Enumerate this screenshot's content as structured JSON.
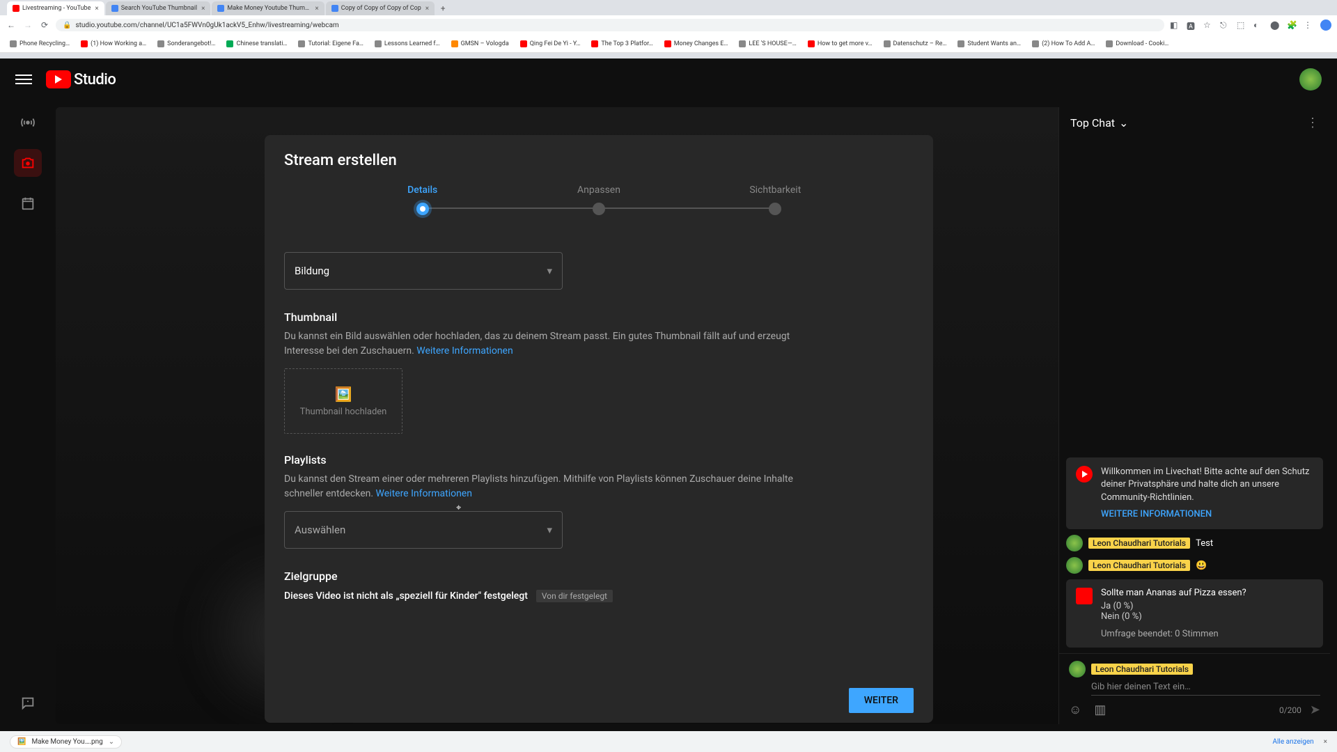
{
  "browser": {
    "tabs": [
      {
        "title": "Livestreaming - YouTube",
        "active": true
      },
      {
        "title": "Search YouTube Thumbnail",
        "active": false
      },
      {
        "title": "Make Money Youtube Thumbn",
        "active": false
      },
      {
        "title": "Copy of Copy of Copy of Cop",
        "active": false
      }
    ],
    "url": "studio.youtube.com/channel/UC1a5FWVn0gUk1ackV5_Enhw/livestreaming/webcam",
    "bookmarks": [
      "Phone Recycling…",
      "(1) How Working a…",
      "Sonderangebot!…",
      "Chinese translati…",
      "Tutorial: Eigene Fa…",
      "Lessons Learned f…",
      "GMSN – Vologda",
      "Qing Fei De Yi - Y…",
      "The Top 3 Platfor…",
      "Money Changes E…",
      "LEE 'S HOUSE—…",
      "How to get more v…",
      "Datenschutz – Re…",
      "Student Wants an…",
      "(2) How To Add A…",
      "Download - Cooki…"
    ]
  },
  "header": {
    "logo_text": "Studio"
  },
  "dialog": {
    "title": "Stream erstellen",
    "steps": [
      "Details",
      "Anpassen",
      "Sichtbarkeit"
    ],
    "active_step": 0,
    "category": {
      "value": "Bildung"
    },
    "thumbnail": {
      "heading": "Thumbnail",
      "desc": "Du kannst ein Bild auswählen oder hochladen, das zu deinem Stream passt. Ein gutes Thumbnail fällt auf und erzeugt Interesse bei den Zuschauern. ",
      "link": "Weitere Informationen",
      "upload_label": "Thumbnail hochladen"
    },
    "playlists": {
      "heading": "Playlists",
      "desc": "Du kannst den Stream einer oder mehreren Playlists hinzufügen. Mithilfe von Playlists können Zuschauer deine Inhalte schneller entdecken. ",
      "link": "Weitere Informationen",
      "select_placeholder": "Auswählen"
    },
    "audience": {
      "heading": "Zielgruppe",
      "statement": "Dieses Video ist nicht als „speziell für Kinder\" festgelegt",
      "badge": "Von dir festgelegt"
    },
    "next_btn": "WEITER"
  },
  "chat": {
    "title": "Top Chat",
    "notice": {
      "text": "Willkommen im Livechat! Bitte achte auf den Schutz deiner Privatsphäre und halte dich an unsere Community-Richtlinien.",
      "link": "WEITERE INFORMATIONEN"
    },
    "messages": [
      {
        "user": "Leon Chaudhari Tutorials",
        "text": "Test"
      },
      {
        "user": "Leon Chaudhari Tutorials",
        "text": "😃"
      }
    ],
    "poll": {
      "question": "Sollte man Ananas auf Pizza essen?",
      "options": [
        "Ja (0 %)",
        "Nein (0 %)"
      ],
      "ended": "Umfrage beendet: 0 Stimmen"
    },
    "input": {
      "user": "Leon Chaudhari Tutorials",
      "placeholder": "Gib hier deinen Text ein…",
      "counter": "0/200"
    }
  },
  "downloads": {
    "item": "Make Money You….png",
    "show_all": "Alle anzeigen"
  }
}
